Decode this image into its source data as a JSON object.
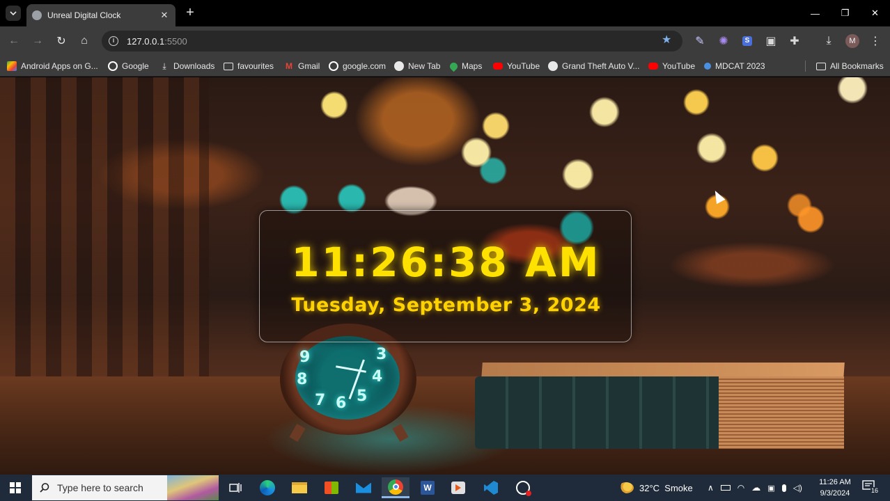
{
  "browser": {
    "tab_title": "Unreal Digital Clock",
    "url_host": "127.0.0.1",
    "url_port": ":5500"
  },
  "bookmarks": {
    "items": [
      {
        "label": "Android Apps on G...",
        "icon": "play-store-icon",
        "color": "#34a853"
      },
      {
        "label": "Google",
        "icon": "google-icon",
        "color": "#ffffff"
      },
      {
        "label": "Downloads",
        "icon": "download-icon",
        "color": "#e8e8e8"
      },
      {
        "label": "favourites",
        "icon": "folder-icon",
        "color": "#e8e8e8"
      },
      {
        "label": "Gmail",
        "icon": "gmail-icon",
        "color": "#ea4335"
      },
      {
        "label": "google.com",
        "icon": "google-icon",
        "color": "#ffffff"
      },
      {
        "label": "New Tab",
        "icon": "globe-icon",
        "color": "#ffffff"
      },
      {
        "label": "Maps",
        "icon": "maps-icon",
        "color": "#34a853"
      },
      {
        "label": "YouTube",
        "icon": "youtube-icon",
        "color": "#ff0000"
      },
      {
        "label": "Grand Theft Auto V...",
        "icon": "globe-icon",
        "color": "#ffffff"
      },
      {
        "label": "YouTube",
        "icon": "youtube-icon",
        "color": "#ff0000"
      },
      {
        "label": "MDCAT 2023",
        "icon": "site-icon",
        "color": "#4a90e2"
      }
    ],
    "all_bookmarks": "All Bookmarks"
  },
  "profile": {
    "initial": "M"
  },
  "clock": {
    "time": "11:26:38 AM",
    "date": "Tuesday, September 3, 2024",
    "text_color": "#ffe100"
  },
  "taskbar": {
    "search_placeholder": "Type here to search",
    "weather": "32°C  Smoke",
    "time": "11:26 AM",
    "date": "9/3/2024",
    "notification_count": "16"
  }
}
